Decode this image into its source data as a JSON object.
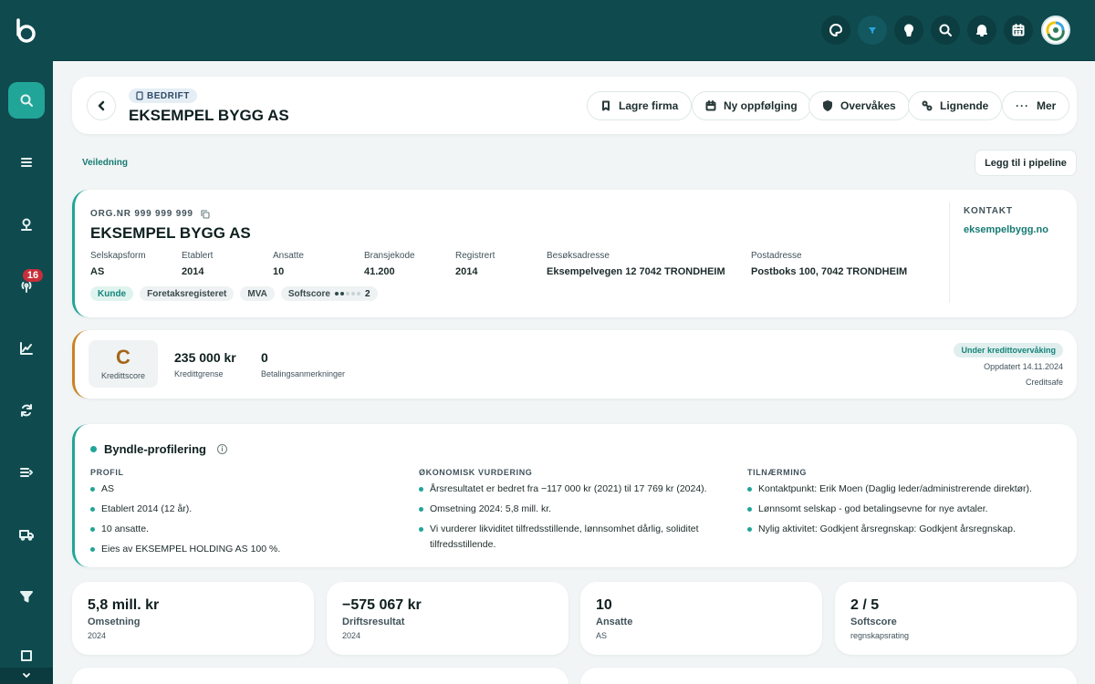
{
  "header": {
    "type_label": "BEDRIFT",
    "title": "EKSEMPEL BYGG AS",
    "buttons": {
      "save": "Lagre firma",
      "followup": "Ny oppfølging",
      "monitored": "Overvåkes",
      "similar": "Lignende",
      "more": "Mer"
    }
  },
  "guide_link": "Veiledning",
  "pipeline_button": "Legg til i pipeline",
  "sidebar": {
    "badge": "16"
  },
  "company": {
    "orgnr": "ORG.NR 999 999 999",
    "name": "EKSEMPEL BYGG AS",
    "fields": [
      {
        "key": "Selskapsform",
        "value": "AS"
      },
      {
        "key": "Etablert",
        "value": "2014"
      },
      {
        "key": "Ansatte",
        "value": "10"
      },
      {
        "key": "Bransjekode",
        "value": "41.200"
      },
      {
        "key": "Registrert",
        "value": "2014"
      },
      {
        "key": "Besøksadresse",
        "value": "Eksempelvegen 12 7042 TRONDHEIM"
      },
      {
        "key": "Postadresse",
        "value": "Postboks 100, 7042 TRONDHEIM"
      }
    ],
    "tags": [
      "Kunde",
      "Foretaksregisteret",
      "MVA"
    ],
    "softscore_tag": {
      "label": "Softscore",
      "value": "2",
      "level": 2,
      "max": 5
    },
    "contact_label": "KONTAKT",
    "contact_link": "eksempelbygg.no"
  },
  "credit": {
    "score": "C",
    "score_label": "Kredittscore",
    "limit_value": "235 000 kr",
    "limit_label": "Kredittgrense",
    "remarks_value": "0",
    "remarks_label": "Betalingsanmerkninger",
    "status_pill": "Under kredittovervåking",
    "updated": "Oppdatert 14.11.2024",
    "source": "Creditsafe"
  },
  "profiling": {
    "title": "Byndle-profilering",
    "columns": [
      {
        "heading": "PROFIL",
        "items": [
          "AS",
          "Etablert 2014 (12 år).",
          "10 ansatte.",
          "Eies av EKSEMPEL HOLDING AS 100 %."
        ]
      },
      {
        "heading": "ØKONOMISK VURDERING",
        "items": [
          "Årsresultatet er bedret fra −117 000 kr (2021) til 17 769 kr (2024).",
          "Omsetning 2024: 5,8 mill. kr.",
          "Vi vurderer likviditet tilfredsstillende, lønnsomhet dårlig, soliditet tilfredsstillende."
        ]
      },
      {
        "heading": "TILNÆRMING",
        "items": [
          "Kontaktpunkt: Erik Moen (Daglig leder/administrerende direktør).",
          "Lønnsomt selskap - god betalingsevne for nye avtaler.",
          "Nylig aktivitet: Godkjent årsregnskap: Godkjent årsregnskap."
        ]
      }
    ]
  },
  "stats": [
    {
      "value": "5,8 mill. kr",
      "label": "Omsetning",
      "sub": "2024"
    },
    {
      "value": "−575 067 kr",
      "label": "Driftsresultat",
      "sub": "2024"
    },
    {
      "value": "10",
      "label": "Ansatte",
      "sub": "AS"
    },
    {
      "value": "2 / 5",
      "label": "Softscore",
      "sub": "regnskapsrating"
    }
  ],
  "colors": {
    "primary": "#0f4a4f",
    "accent": "#21a598",
    "credit": "#c98324"
  }
}
